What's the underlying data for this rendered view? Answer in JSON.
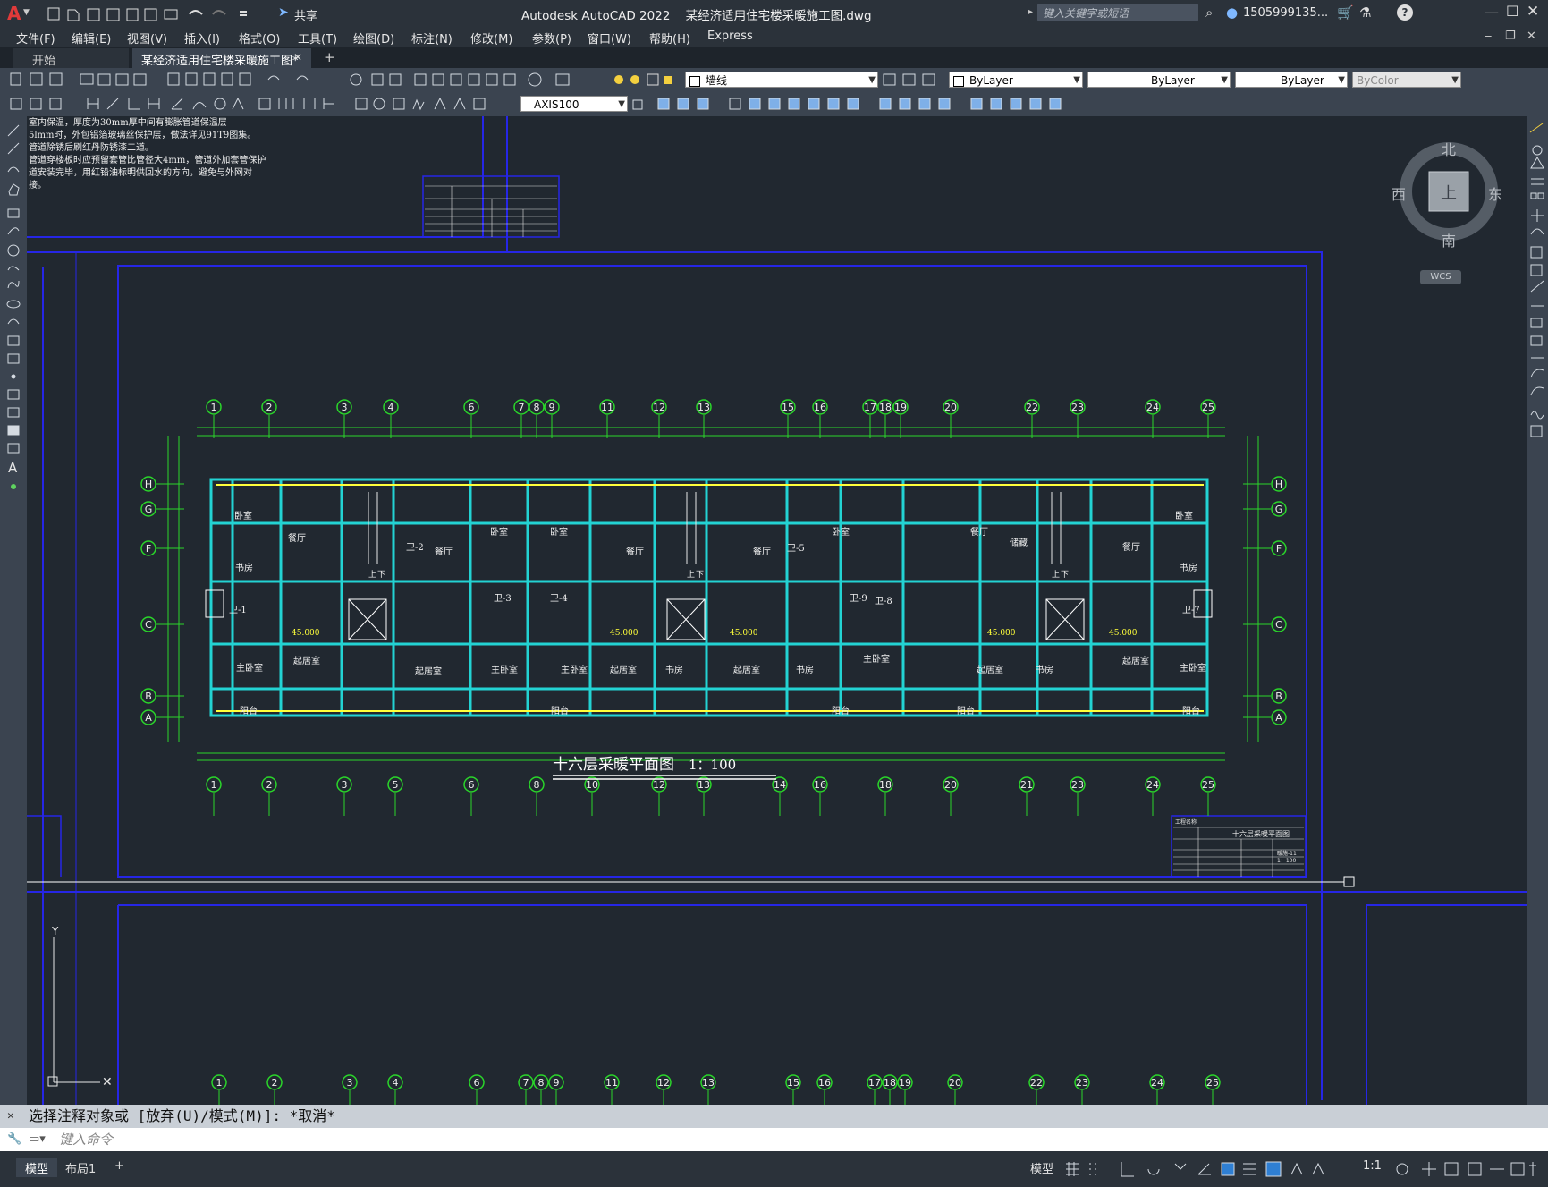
{
  "app": {
    "logo": "A",
    "window_title": "Autodesk AutoCAD 2022    某经济适用住宅楼采暖施工图.dwg",
    "share_label": "共享",
    "search_placeholder": "键入关键字或短语",
    "user": "1505999135...",
    "help": "?"
  },
  "menu": [
    "文件(F)",
    "编辑(E)",
    "视图(V)",
    "插入(I)",
    "格式(O)",
    "工具(T)",
    "绘图(D)",
    "标注(N)",
    "修改(M)",
    "参数(P)",
    "窗口(W)",
    "帮助(H)",
    "Express"
  ],
  "tabs": {
    "start": "开始",
    "drawing": "某经济适用住宅楼采暖施工图*",
    "close": "✕",
    "add": "+"
  },
  "toolbar": {
    "layer": "墙线",
    "color": "ByLayer",
    "linetype": "ByLayer",
    "lineweight": "ByLayer",
    "plotstyle": "ByColor",
    "dimstyle": "AXIS100"
  },
  "viewcube": {
    "n": "北",
    "s": "南",
    "e": "东",
    "w": "西",
    "top": "上",
    "wcs": "WCS"
  },
  "drawing": {
    "title": "十六层采暖平面图",
    "scale": "1：100",
    "notes": [
      "室内保温，厚度为30mm厚中间有膨胀管道保温层",
      "5lmm时，外包铝箔玻璃丝保护层，做法详见91T9图集。",
      "管道除锈后刷红丹防锈漆二道。",
      "管道穿楼板时应预留套管比管径大4mm，管道外加套管保护",
      "道安装完毕，用红铅油标明供回水的方向，避免与外网对",
      "接。"
    ],
    "axes_top": [
      "1",
      "2",
      "3",
      "4",
      "6",
      "7",
      "8",
      "9",
      "11",
      "12",
      "13",
      "15",
      "16",
      "17",
      "18",
      "19",
      "20",
      "22",
      "23",
      "24",
      "25"
    ],
    "axes_bottom": [
      "1",
      "2",
      "3",
      "5",
      "6",
      "8",
      "10",
      "12",
      "13",
      "14",
      "16",
      "18",
      "20",
      "21",
      "23",
      "24",
      "25"
    ],
    "axes_left": [
      "H",
      "G",
      "F",
      "C",
      "B",
      "A"
    ],
    "rooms_a": [
      "卧室",
      "餐厅",
      "书房",
      "起居室",
      "主卧室",
      "阳台",
      "卫-1",
      "卫-2",
      "餐厅",
      "卧室",
      "卫-3",
      "主卧室",
      "起居室"
    ],
    "rooms_b": [
      "卧室",
      "卫-4",
      "主卧室",
      "起居室",
      "餐厅",
      "书房",
      "阳台"
    ],
    "rooms_c": [
      "卫-5",
      "餐厅",
      "起居室",
      "卧室",
      "卫-9",
      "卫-8",
      "主卧室",
      "书房",
      "阳台"
    ],
    "rooms_d": [
      "餐厅",
      "储藏",
      "起居室",
      "书房",
      "阳台",
      "卧室",
      "餐厅",
      "书房",
      "卫-7",
      "起居室",
      "主卧室",
      "阳台"
    ],
    "stair_labels": [
      "上",
      "下",
      "上",
      "下",
      "上",
      "下"
    ],
    "dims_text": [
      "45.000",
      "45.000",
      "45.000",
      "45.000",
      "45.000"
    ],
    "titleblock": {
      "line1": "工程名称",
      "line2": "十六层采暖平面图",
      "line3": "暖施-11",
      "line4": "1：100"
    }
  },
  "command": {
    "history": "选择注释对象或 [放弃(U)/模式(M)]: *取消*",
    "placeholder": "键入命令"
  },
  "status": {
    "model_tab": "模型",
    "layout_tab": "布局1",
    "add": "+",
    "model": "模型",
    "scale": "1:1"
  }
}
